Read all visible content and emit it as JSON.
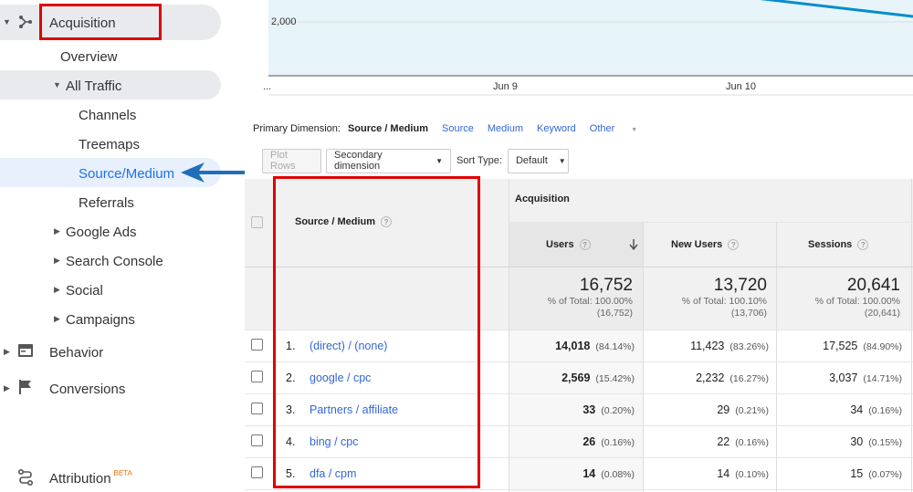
{
  "sidebar": {
    "acquisition_label": "Acquisition",
    "overview_label": "Overview",
    "all_traffic_label": "All Traffic",
    "channels_label": "Channels",
    "treemaps_label": "Treemaps",
    "source_medium_label": "Source/Medium",
    "referrals_label": "Referrals",
    "google_ads_label": "Google Ads",
    "search_console_label": "Search Console",
    "social_label": "Social",
    "campaigns_label": "Campaigns",
    "behavior_label": "Behavior",
    "conversions_label": "Conversions",
    "attribution_label": "Attribution",
    "beta_label": "BETA"
  },
  "chart": {
    "y_tick": "2,000",
    "x_start": "...",
    "x_ticks": [
      "Jun 9",
      "Jun 10"
    ]
  },
  "dimension_bar": {
    "label": "Primary Dimension:",
    "selected": "Source / Medium",
    "options": [
      "Source",
      "Medium",
      "Keyword"
    ],
    "other_label": "Other"
  },
  "toolbar": {
    "plot_rows_label": "Plot Rows",
    "secondary_dimension_label": "Secondary dimension",
    "sort_type_label": "Sort Type:",
    "sort_type_value": "Default"
  },
  "table": {
    "dimension_header": "Source / Medium",
    "group_header": "Acquisition",
    "columns": [
      "Users",
      "New Users",
      "Sessions"
    ],
    "totals": [
      {
        "value": "16,752",
        "pct_line": "% of Total: 100.00%",
        "abs_line": "(16,752)"
      },
      {
        "value": "13,720",
        "pct_line": "% of Total: 100.10%",
        "abs_line": "(13,706)"
      },
      {
        "value": "20,641",
        "pct_line": "% of Total: 100.00%",
        "abs_line": "(20,641)"
      }
    ],
    "rows": [
      {
        "index": "1.",
        "name": "(direct) / (none)",
        "users": "14,018",
        "users_pct": "(84.14%)",
        "new_users": "11,423",
        "new_users_pct": "(83.26%)",
        "sessions": "17,525",
        "sessions_pct": "(84.90%)"
      },
      {
        "index": "2.",
        "name": "google / cpc",
        "users": "2,569",
        "users_pct": "(15.42%)",
        "new_users": "2,232",
        "new_users_pct": "(16.27%)",
        "sessions": "3,037",
        "sessions_pct": "(14.71%)"
      },
      {
        "index": "3.",
        "name": "Partners / affiliate",
        "users": "33",
        "users_pct": "(0.20%)",
        "new_users": "29",
        "new_users_pct": "(0.21%)",
        "sessions": "34",
        "sessions_pct": "(0.16%)"
      },
      {
        "index": "4.",
        "name": "bing / cpc",
        "users": "26",
        "users_pct": "(0.16%)",
        "new_users": "22",
        "new_users_pct": "(0.16%)",
        "sessions": "30",
        "sessions_pct": "(0.15%)"
      },
      {
        "index": "5.",
        "name": "dfa / cpm",
        "users": "14",
        "users_pct": "(0.08%)",
        "new_users": "14",
        "new_users_pct": "(0.10%)",
        "sessions": "15",
        "sessions_pct": "(0.07%)"
      }
    ]
  },
  "colors": {
    "highlight_red": "#e00000",
    "link_blue": "#3367d6",
    "chart_line": "#058dc7",
    "chart_fill": "#e7f4f9",
    "arrow_blue": "#1f6fb8"
  }
}
